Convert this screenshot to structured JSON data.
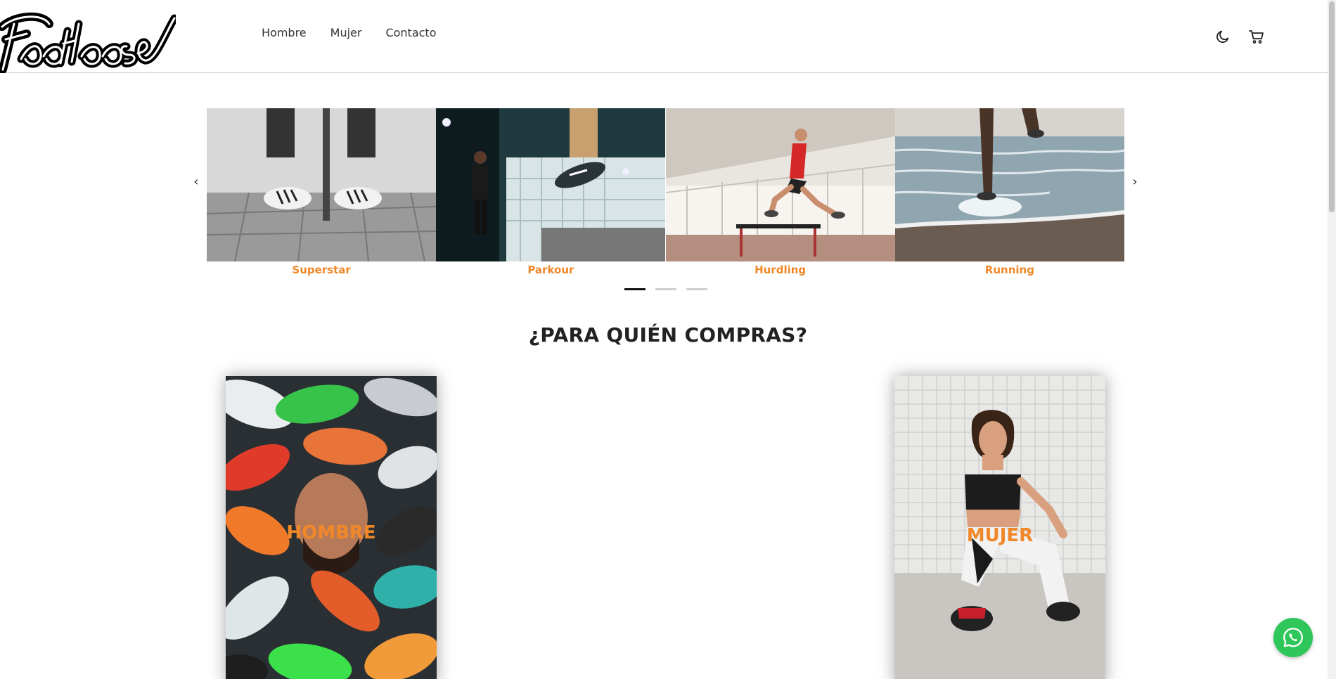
{
  "header": {
    "logo_text": "Footloose",
    "nav": [
      "Hombre",
      "Mujer",
      "Contacto"
    ],
    "icons": [
      "moon-icon",
      "cart-icon"
    ]
  },
  "carousel": {
    "slides": [
      {
        "caption": "Superstar"
      },
      {
        "caption": "Parkour"
      },
      {
        "caption": "Hurdling"
      },
      {
        "caption": "Running"
      }
    ],
    "prev_label": "‹",
    "next_label": "›",
    "dots": 3,
    "active_dot": 0
  },
  "section": {
    "title": "¿PARA QUIÉN COMPRAS?"
  },
  "categories": {
    "men_label": "HOMBRE",
    "women_label": "MUJER"
  },
  "colors": {
    "accent": "#f0882a",
    "whatsapp": "#2fc65a",
    "text": "#222222"
  }
}
